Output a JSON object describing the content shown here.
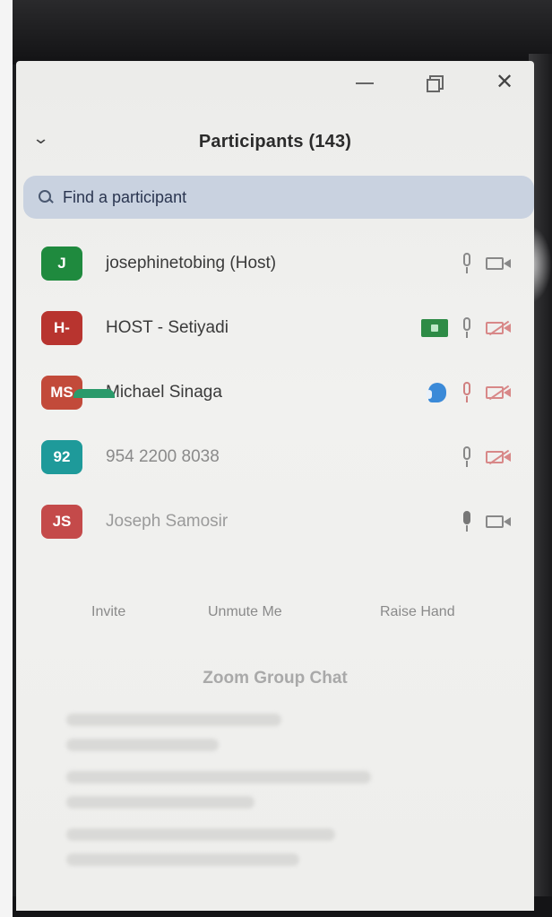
{
  "panel": {
    "title": "Participants (143)",
    "search": {
      "placeholder": "Find a participant"
    },
    "participants": [
      {
        "initials": "J",
        "name": "josephinetobing (Host)",
        "avatar_color": "#1f8a3e"
      },
      {
        "initials": "H-",
        "name": "HOST - Setiyadi",
        "avatar_color": "#b8342f"
      },
      {
        "initials": "MS",
        "name": "Michael Sinaga",
        "avatar_color": "#c24a3a"
      },
      {
        "initials": "92",
        "name": "954 2200 8038",
        "avatar_color": "#1e9a9a"
      },
      {
        "initials": "JS",
        "name": "Joseph Samosir",
        "avatar_color": "#c44a4a"
      }
    ],
    "actions": {
      "invite": "Invite",
      "unmute": "Unmute Me",
      "raise_hand": "Raise Hand"
    },
    "chat_title": "Zoom Group Chat"
  }
}
